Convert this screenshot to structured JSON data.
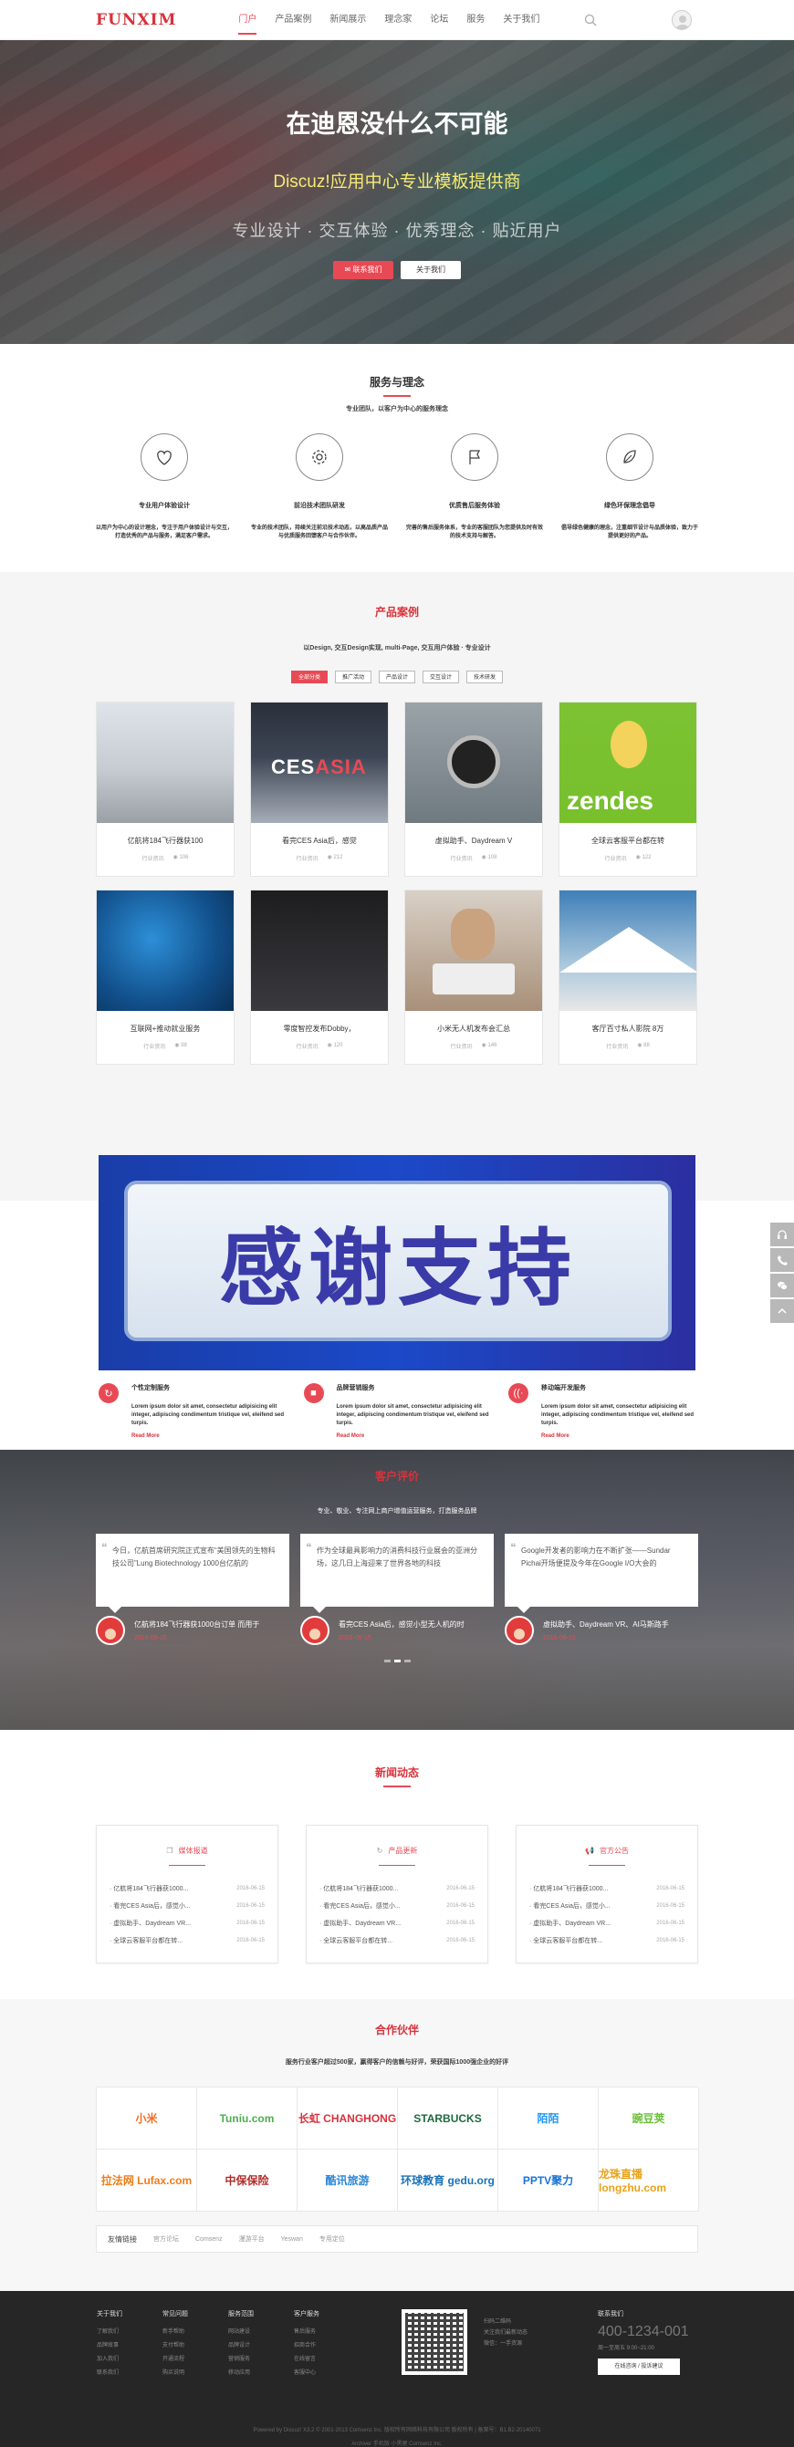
{
  "header": {
    "logo": "FUNXIM",
    "nav": [
      "门户",
      "产品案例",
      "新闻展示",
      "理念家",
      "论坛",
      "服务",
      "关于我们"
    ],
    "active_index": 0
  },
  "hero": {
    "title": "在迪恩没什么不可能",
    "subtitle": "Discuz!应用中心专业模板提供商",
    "tagline": "专业设计 · 交互体验 · 优秀理念 · 贴近用户",
    "btn_primary": "联系我们",
    "btn_secondary": "关于我们"
  },
  "features": {
    "title": "服务与理念",
    "subtitle": "专业团队，以客户为中心的服务理念",
    "items": [
      {
        "icon": "heart-icon",
        "title": "专业用户体验设计",
        "desc": "以用户为中心的设计理念，专注于用户体验设计与交互，打造优秀的产品与服务，满足客户需求。"
      },
      {
        "icon": "gear-icon",
        "title": "前沿技术团队研发",
        "desc": "专业的技术团队，持续关注前沿技术动态，以高品质产品与优质服务回馈客户与合作伙伴。"
      },
      {
        "icon": "flag-icon",
        "title": "优质售后服务体验",
        "desc": "完善的售后服务体系，专业的客服团队为您提供及时有效的技术支持与解答。"
      },
      {
        "icon": "leaf-icon",
        "title": "绿色环保理念倡导",
        "desc": "倡导绿色健康的理念，注重细节设计与品质体验，致力于提供更好的产品。"
      }
    ]
  },
  "products": {
    "title": "产品案例",
    "subtitle": "以Design, 交互Design实现, multi-Page, 交互用户体验 · 专业设计",
    "tabs": [
      "全部分类",
      "推广活动",
      "产品设计",
      "交互设计",
      "技术研发"
    ],
    "cards": [
      {
        "title": "亿航将184飞行器获100",
        "cat": "行业资讯",
        "views": "106"
      },
      {
        "title": "看完CES Asia后，感觉",
        "cat": "行业资讯",
        "views": "212"
      },
      {
        "title": "虚拟助手、Daydream V",
        "cat": "行业资讯",
        "views": "108"
      },
      {
        "title": "全球云客服平台都在转",
        "cat": "行业资讯",
        "views": "122"
      },
      {
        "title": "互联网+推动就业服务",
        "cat": "行业资讯",
        "views": "98"
      },
      {
        "title": "零度智控发布Dobby，",
        "cat": "行业资讯",
        "views": "120"
      },
      {
        "title": "小米无人机发布会汇总",
        "cat": "行业资讯",
        "views": "146"
      },
      {
        "title": "客厅百寸私人影院 8万",
        "cat": "行业资讯",
        "views": "88"
      }
    ]
  },
  "banner": {
    "text": "感谢支持",
    "services": [
      {
        "icon": "refresh-icon",
        "title": "个性定制服务",
        "desc": "Lorem ipsum dolor sit amet, consectetur adipisicing elit integer, adipiscing condimentum tristique vel, eleifend sed turpis.",
        "more": "Read More"
      },
      {
        "icon": "stop-icon",
        "title": "品牌营销服务",
        "desc": "Lorem ipsum dolor sit amet, consectetur adipisicing elit integer, adipiscing condimentum tristique vel, eleifend sed turpis.",
        "more": "Read More"
      },
      {
        "icon": "wifi-icon",
        "title": "移动端开发服务",
        "desc": "Lorem ipsum dolor sit amet, consectetur adipisicing elit integer, adipiscing condimentum tristique vel, eleifend sed turpis.",
        "more": "Read More"
      }
    ]
  },
  "testimonials": {
    "title": "客户评价",
    "subtitle": "专业、敬业、专注网上商户增值运营服务，打造服务品牌",
    "items": [
      {
        "quote": "今日，亿航首席研究院正式宣布“美国领先的生物科技公司”Lung Biotechnology 1000台亿航的",
        "name": "亿航将184飞行器获1000台订单 而用于",
        "date": "2016-06-15"
      },
      {
        "quote": "作为全球最具影响力的消费科技行业展会的亚洲分场，这几日上海迎来了世界各地的科技",
        "name": "看完CES Asia后，感觉小型无人机的时",
        "date": "2016-06-15"
      },
      {
        "quote": "Google开发者的影响力在不断扩张——Sundar Pichai开场便提及今年在Google I/O大会的",
        "name": "虚拟助手、Daydream VR、AI马斯路手",
        "date": "2016-06-15"
      }
    ]
  },
  "news": {
    "title": "新闻动态",
    "cols": [
      {
        "icon": "copy-icon",
        "title": "媒体报道",
        "items": [
          {
            "t": "亿航将184飞行器获1000...",
            "d": "2016-06-15"
          },
          {
            "t": "看完CES Asia后，感觉小...",
            "d": "2016-06-15"
          },
          {
            "t": "虚拟助手、Daydream VR...",
            "d": "2016-06-15"
          },
          {
            "t": "全球云客服平台都在转...",
            "d": "2016-06-15"
          }
        ]
      },
      {
        "icon": "refresh-icon",
        "title": "产品更新",
        "items": [
          {
            "t": "亿航将184飞行器获1000...",
            "d": "2016-06-15"
          },
          {
            "t": "看完CES Asia后，感觉小...",
            "d": "2016-06-15"
          },
          {
            "t": "虚拟助手、Daydream VR...",
            "d": "2016-06-15"
          },
          {
            "t": "全球云客服平台都在转...",
            "d": "2016-06-15"
          }
        ]
      },
      {
        "icon": "megaphone-icon",
        "title": "官方公告",
        "items": [
          {
            "t": "亿航将184飞行器获1000...",
            "d": "2016-06-15"
          },
          {
            "t": "看完CES Asia后，感觉小...",
            "d": "2016-06-15"
          },
          {
            "t": "虚拟助手、Daydream VR...",
            "d": "2016-06-15"
          },
          {
            "t": "全球云客服平台都在转...",
            "d": "2016-06-15"
          }
        ]
      }
    ]
  },
  "partners": {
    "title": "合作伙伴",
    "subtitle": "服务行业客户超过500家，赢得客户的信赖与好评，荣获国际1000强企业的好评",
    "logos": [
      {
        "name": "小米",
        "color": "#f36c21"
      },
      {
        "name": "Tuniu.com",
        "color": "#4caf50"
      },
      {
        "name": "长虹 CHANGHONG",
        "color": "#d8323c"
      },
      {
        "name": "STARBUCKS",
        "color": "#1e6b3f"
      },
      {
        "name": "陌陌",
        "color": "#2196f3"
      },
      {
        "name": "豌豆荚",
        "color": "#6cbf3a"
      },
      {
        "name": "拉法网 Lufax.com",
        "color": "#f07c1a"
      },
      {
        "name": "中保保险",
        "color": "#b22a2a"
      },
      {
        "name": "酷讯旅游",
        "color": "#2a86d8"
      },
      {
        "name": "环球教育 gedu.org",
        "color": "#1a73b8"
      },
      {
        "name": "PPTV聚力",
        "color": "#1a73d8"
      },
      {
        "name": "龙珠直播 longzhu.com",
        "color": "#e8a21a"
      }
    ],
    "links_title": "友情链接",
    "links": [
      "官方论坛",
      "Comsenz",
      "漫游平台",
      "Yeswan",
      "专用定位"
    ]
  },
  "footer": {
    "cols": [
      {
        "h": "关于我们",
        "items": [
          "了解我们",
          "品牌故事",
          "加入我们",
          "联系我们"
        ]
      },
      {
        "h": "常见问题",
        "items": [
          "新手帮助",
          "支付帮助",
          "开通流程",
          "购买说明"
        ]
      },
      {
        "h": "服务范围",
        "items": [
          "网站建设",
          "品牌设计",
          "营销服务",
          "移动应用"
        ]
      },
      {
        "h": "客户服务",
        "items": [
          "售后服务",
          "招商合作",
          "在线留言",
          "客服中心"
        ]
      }
    ],
    "qr_text": [
      "扫码二维码",
      "关注我们最新动态",
      "微信：一手资源"
    ],
    "contact_title": "联系我们",
    "tel": "400-1234-001",
    "time": "周一至周五 9:00~21:00",
    "contact_btn": "在线咨询 / 投诉建议",
    "copyright": "Powered by Discuz! X3.2 © 2001-2013 Comsenz Inc.   版权所有网络科技有限公司 版权所有  |  备案号：B1.B2-20140071",
    "bottom": "Archiver   手机版   小黑屋   Comsenz Inc."
  }
}
